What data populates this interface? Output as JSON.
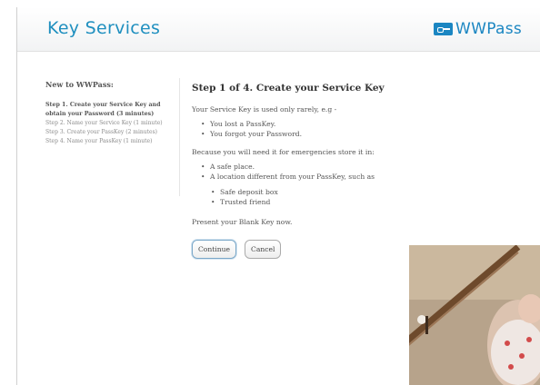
{
  "header": {
    "title": "Key Services",
    "brand": "WWPass",
    "icon": "key-icon"
  },
  "sidebar": {
    "title": "New to WWPass:",
    "steps": [
      "Step 1. Create your Service Key and obtain your Password (3 minutes)",
      "Step 2. Name your Service Key (1 minute)",
      "Step 3. Create your PassKey (2 minutes)",
      "Step 4. Name your PassKey (1 minute)"
    ]
  },
  "main": {
    "title": "Step 1 of 4. Create your Service Key",
    "intro": "Your Service Key is used only rarely, e.g -",
    "reasons": [
      "You lost a PassKey.",
      "You forgot your Password."
    ],
    "storage_intro": "Because you will need it for emergencies store it in:",
    "storage_places": [
      "A safe place.",
      "A location different from your PassKey, such as"
    ],
    "examples": [
      "Safe deposit box",
      "Trusted friend"
    ],
    "prompt": "Present your Blank Key now.",
    "continue_label": "Continue",
    "cancel_label": "Cancel"
  },
  "colors": {
    "accent": "#1f8fbf",
    "brand": "#1b86c2"
  }
}
